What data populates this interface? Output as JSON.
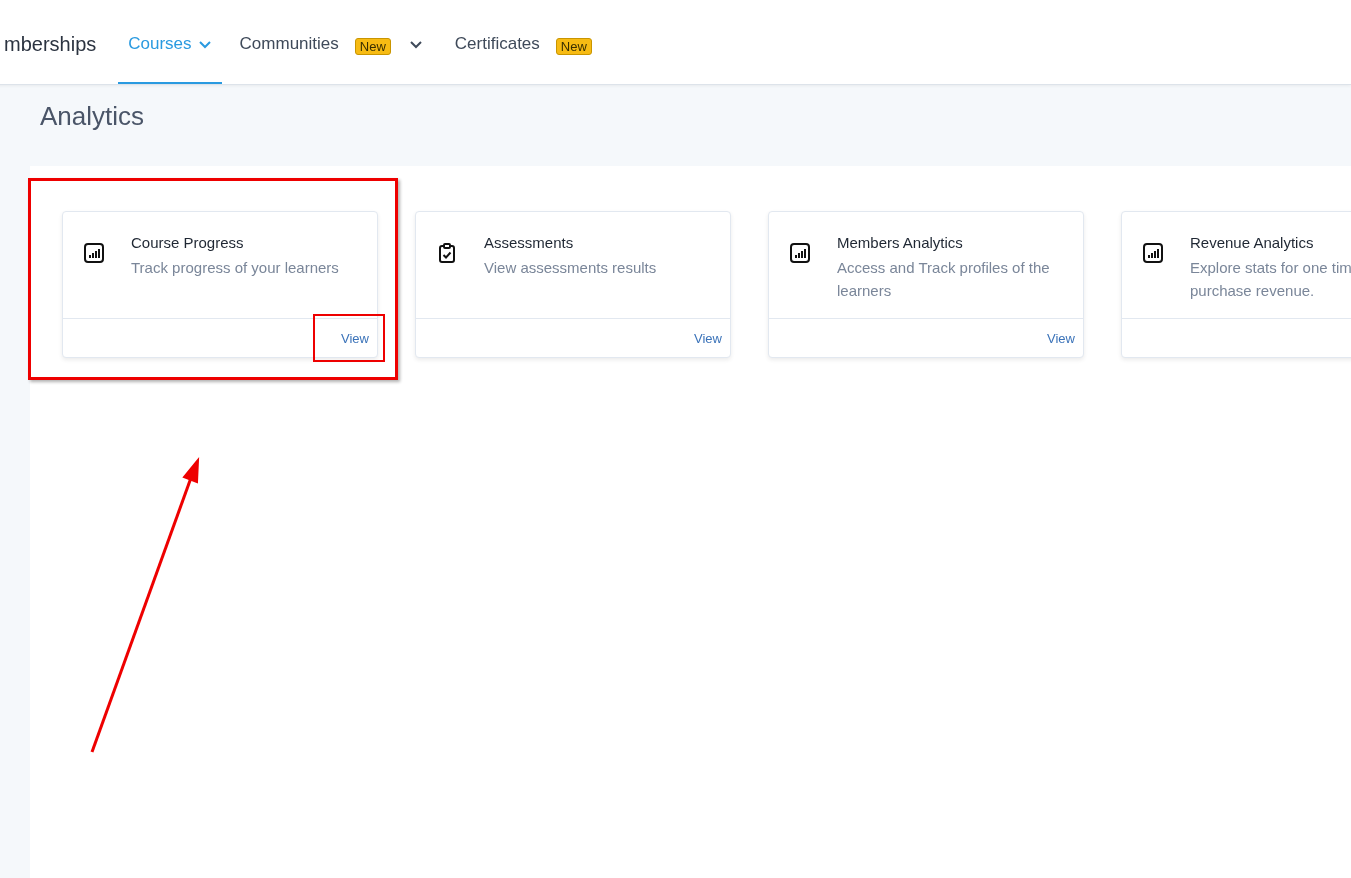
{
  "nav": {
    "items": [
      {
        "label": "mberships",
        "selected": false,
        "dropdown": false
      },
      {
        "label": "Courses",
        "selected": true,
        "dropdown": true
      },
      {
        "label": "Communities",
        "selected": false,
        "dropdown": true,
        "badge": "New"
      },
      {
        "label": "Certificates",
        "selected": false,
        "dropdown": false,
        "badge": "New"
      }
    ]
  },
  "page_title": "Analytics",
  "cards": [
    {
      "kind": "chart",
      "title": "Course Progress",
      "description_lines": [
        "Track progress of your learners"
      ],
      "action": "View",
      "highlighted": true
    },
    {
      "kind": "clipboard",
      "title": "Assessments",
      "description_lines": [
        "View assessments results"
      ],
      "action": "View",
      "highlighted": false
    },
    {
      "kind": "chart",
      "title": "Members Analytics",
      "description_lines": [
        "Access and Track profiles of the",
        "learners"
      ],
      "action": "View",
      "highlighted": false
    },
    {
      "kind": "chart",
      "title": "Revenue Analytics",
      "description_lines": [
        "Explore stats for one tim",
        "purchase revenue."
      ],
      "highlighted": false
    }
  ],
  "annotation_arrow": true
}
